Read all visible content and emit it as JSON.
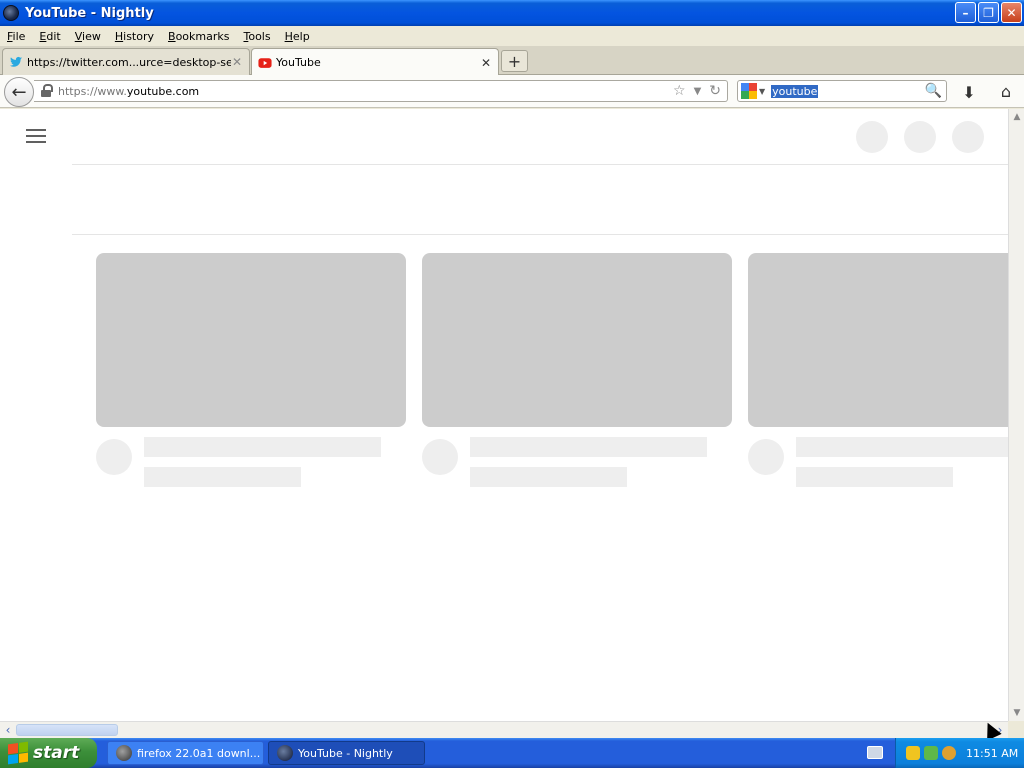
{
  "window": {
    "title": "YouTube - Nightly"
  },
  "menu": {
    "items": [
      {
        "first": "F",
        "rest": "ile"
      },
      {
        "first": "E",
        "rest": "dit"
      },
      {
        "first": "V",
        "rest": "iew"
      },
      {
        "first": "H",
        "rest": "istory"
      },
      {
        "first": "B",
        "rest": "ookmarks"
      },
      {
        "first": "T",
        "rest": "ools"
      },
      {
        "first": "H",
        "rest": "elp"
      }
    ]
  },
  "tabs": [
    {
      "label": "https://twitter.com...urce=desktop-search",
      "favicon": "twitter-icon"
    },
    {
      "label": "YouTube",
      "favicon": "youtube-icon"
    }
  ],
  "new_tab_label": "+",
  "address": {
    "prefix": "https://www.",
    "domain": "youtube.com"
  },
  "search": {
    "text": "youtube",
    "engine_icon": "google-icon"
  },
  "taskbar": {
    "start_label": "start",
    "tasks": [
      {
        "label": "firefox 22.0a1 downl..."
      },
      {
        "label": "YouTube - Nightly"
      }
    ],
    "clock": "11:51 AM"
  },
  "colors": {
    "title_bar": "#0454e0",
    "placeholder_thumb": "#cccccc",
    "placeholder_text": "#eeeeee",
    "start_green": "#3c8f3a"
  }
}
